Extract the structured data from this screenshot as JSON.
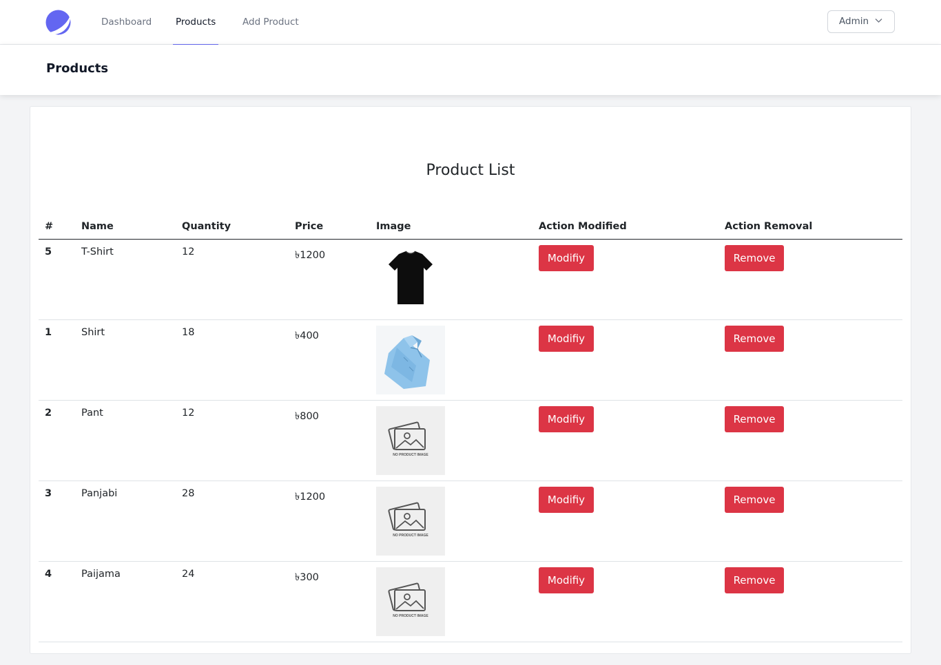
{
  "nav": {
    "links": [
      "Dashboard",
      "Products",
      "Add Product"
    ],
    "active": "Products",
    "account_label": "Admin",
    "accent_color": "#6366f1"
  },
  "page": {
    "title": "Products"
  },
  "card": {
    "title": "Product List"
  },
  "table": {
    "headers": [
      "#",
      "Name",
      "Quantity",
      "Price",
      "Image",
      "Action Modified",
      "Action Removal"
    ],
    "rows": [
      {
        "id": "5",
        "name": "T-Shirt",
        "quantity": "12",
        "price": "৳1200",
        "image": "black-tshirt-image",
        "modify_label": "Modifiy",
        "remove_label": "Remove"
      },
      {
        "id": "1",
        "name": "Shirt",
        "quantity": "18",
        "price": "৳400",
        "image": "blue-shirt-image",
        "modify_label": "Modifiy",
        "remove_label": "Remove"
      },
      {
        "id": "2",
        "name": "Pant",
        "quantity": "12",
        "price": "৳800",
        "image": "no-product-image",
        "modify_label": "Modifiy",
        "remove_label": "Remove"
      },
      {
        "id": "3",
        "name": "Panjabi",
        "quantity": "28",
        "price": "৳1200",
        "image": "no-product-image",
        "modify_label": "Modifiy",
        "remove_label": "Remove"
      },
      {
        "id": "4",
        "name": "Paijama",
        "quantity": "24",
        "price": "৳300",
        "image": "no-product-image",
        "modify_label": "Modifiy",
        "remove_label": "Remove"
      }
    ],
    "placeholder_text": "NO PRODUCT IMAGE",
    "button_color": "#dc3545"
  }
}
